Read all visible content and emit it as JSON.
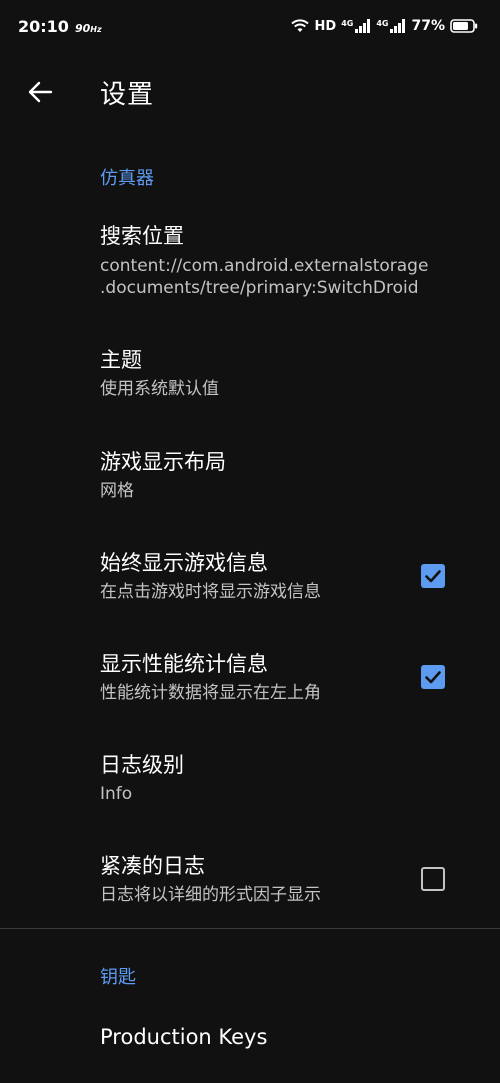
{
  "status_bar": {
    "time": "20:10",
    "refresh": "90",
    "refresh_unit": "Hz",
    "hd": "HD",
    "net1": "4G",
    "net2": "4G",
    "battery": "77%"
  },
  "app_bar": {
    "title": "设置"
  },
  "sections": {
    "emulator": {
      "header": "仿真器"
    },
    "keys": {
      "header": "钥匙"
    }
  },
  "prefs": {
    "search_location": {
      "title": "搜索位置",
      "summary_line1": "content://com.android.externalstorage",
      "summary_line2": ".documents/tree/primary:SwitchDroid"
    },
    "theme": {
      "title": "主题",
      "summary": "使用系统默认值"
    },
    "layout": {
      "title": "游戏显示布局",
      "summary": "网格"
    },
    "always_show_info": {
      "title": "始终显示游戏信息",
      "summary": "在点击游戏时将显示游戏信息",
      "checked": true
    },
    "perf_stats": {
      "title": "显示性能统计信息",
      "summary": "性能统计数据将显示在左上角",
      "checked": true
    },
    "log_level": {
      "title": "日志级别",
      "summary": "Info"
    },
    "compact_log": {
      "title": "紧凑的日志",
      "summary": "日志将以详细的形式因子显示",
      "checked": false
    },
    "production_keys": {
      "title": "Production Keys"
    }
  },
  "colors": {
    "background": "#111111",
    "accent": "#5c9bf0",
    "secondary_text": "#c3c3c3"
  }
}
